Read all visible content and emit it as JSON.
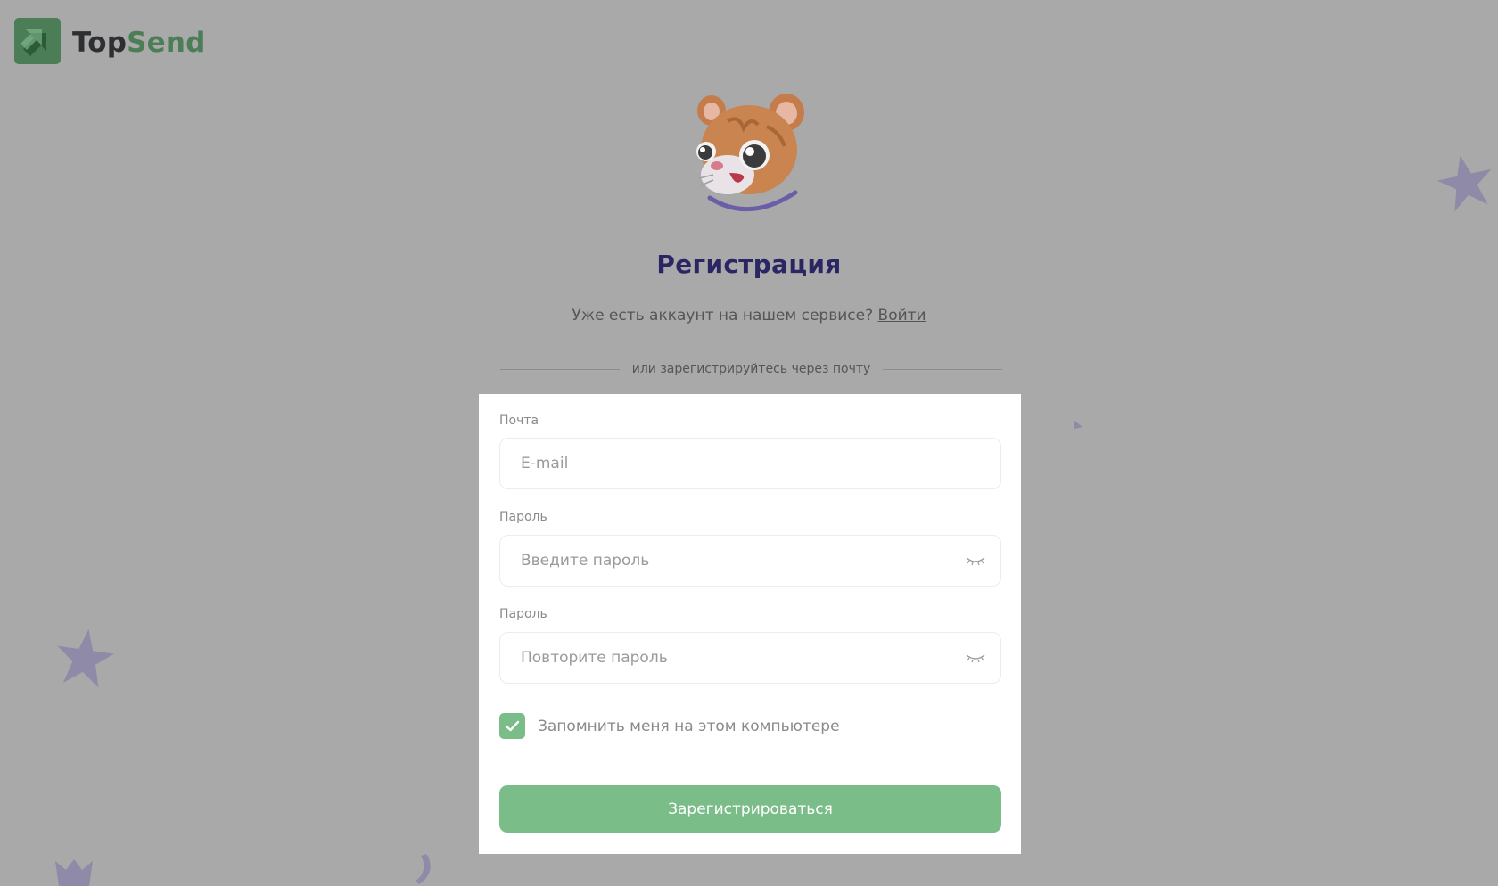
{
  "logo": {
    "part1": "Top",
    "part2": "Send",
    "brand_color": "#4b7d56"
  },
  "mascot": {
    "icon": "hamster-mascot-icon"
  },
  "page": {
    "title": "Регистрация",
    "login_prompt": "Уже есть аккаунт на нашем сервисе?",
    "login_link": "Войти",
    "divider_text": "или зарегистрируйтесь через почту"
  },
  "form": {
    "email": {
      "label": "Почта",
      "placeholder": "E-mail",
      "value": ""
    },
    "password": {
      "label": "Пароль",
      "placeholder": "Введите пароль",
      "value": ""
    },
    "password_repeat": {
      "label": "Пароль",
      "placeholder": "Повторите пароль",
      "value": ""
    },
    "remember": {
      "label": "Запомнить меня на этом компьютере",
      "checked": true
    },
    "submit_label": "Зарегистрироваться"
  },
  "colors": {
    "background": "#a9a9a9",
    "accent": "#7abd88",
    "title": "#2a2563",
    "decoration": "#8e8aa8"
  }
}
